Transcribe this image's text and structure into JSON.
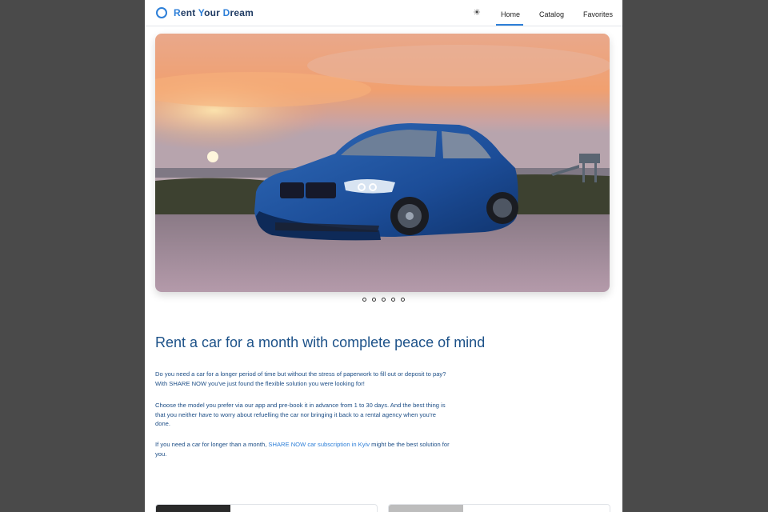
{
  "header": {
    "logo_parts": [
      "R",
      "ent ",
      "Y",
      "our ",
      "D",
      "ream"
    ],
    "theme_icon": "sun-icon",
    "nav": [
      {
        "label": "Home",
        "active": true
      },
      {
        "label": "Catalog",
        "active": false
      },
      {
        "label": "Favorites",
        "active": false
      }
    ]
  },
  "hero": {
    "carousel_dots": 5,
    "active_slide": 1
  },
  "content": {
    "headline": "Rent a car for a month with complete peace of mind",
    "paragraph1": "Do you need a car for a longer period of time but without the stress of paperwork to fill out or deposit to pay? With SHARE NOW you've just found the flexible solution you were looking for!",
    "paragraph2": "Choose the model you prefer via our app and pre-book it in advance from 1 to 30 days. And the best thing is that you neither have to worry about refuelling the car nor bringing it back to a rental agency when you're done.",
    "paragraph3_before": "If you need a car for longer than a month, ",
    "paragraph3_link": "SHARE NOW car subscription in Kyiv",
    "paragraph3_after": " might be the best solution for you."
  },
  "colors": {
    "accent": "#2d7fd8",
    "heading": "#1d5289",
    "body_text": "#1d4e86",
    "backdrop": "#4a4a4a"
  }
}
